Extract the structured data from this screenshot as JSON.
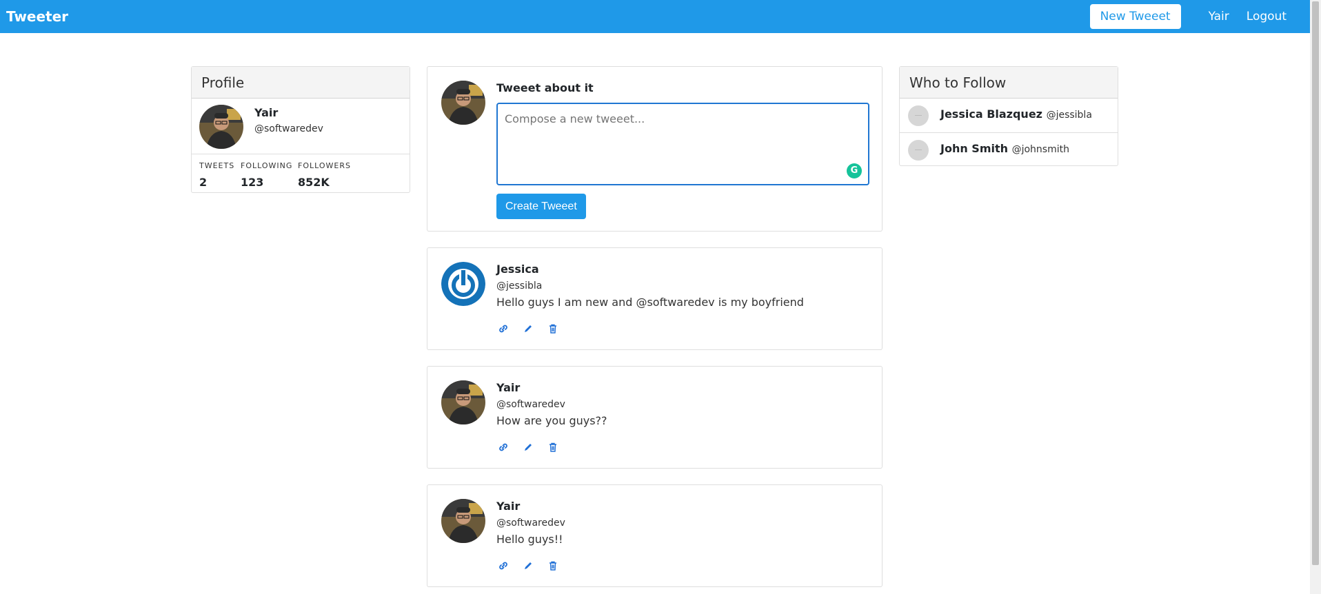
{
  "navbar": {
    "brand": "Tweeter",
    "new_tweet_label": "New Tweeet",
    "user_label": "Yair",
    "logout_label": "Logout",
    "color": "#1f99e8"
  },
  "profile": {
    "header": "Profile",
    "name": "Yair",
    "handle": "@softwaredev",
    "stats": [
      {
        "label": "TWEETS",
        "value": "2"
      },
      {
        "label": "FOLLOWING",
        "value": "123"
      },
      {
        "label": "FOLLOWERS",
        "value": "852K"
      }
    ]
  },
  "compose": {
    "title": "Tweeet about it",
    "placeholder": "Compose a new tweeet...",
    "button_label": "Create Tweeet"
  },
  "tweets": [
    {
      "name": "Jessica",
      "handle": "@jessibla",
      "text": "Hello guys I am new and @softwaredev is my boyfriend",
      "avatar": "power-logo"
    },
    {
      "name": "Yair",
      "handle": "@softwaredev",
      "text": "How are you guys??",
      "avatar": "user-photo"
    },
    {
      "name": "Yair",
      "handle": "@softwaredev",
      "text": "Hello guys!!",
      "avatar": "user-photo"
    }
  ],
  "tweet_actions": [
    "link-icon",
    "pencil-icon",
    "trash-icon"
  ],
  "who_to_follow": {
    "header": "Who to Follow",
    "items": [
      {
        "name": "Jessica Blazquez",
        "handle": "@jessibla"
      },
      {
        "name": "John Smith",
        "handle": "@johnsmith"
      }
    ]
  }
}
